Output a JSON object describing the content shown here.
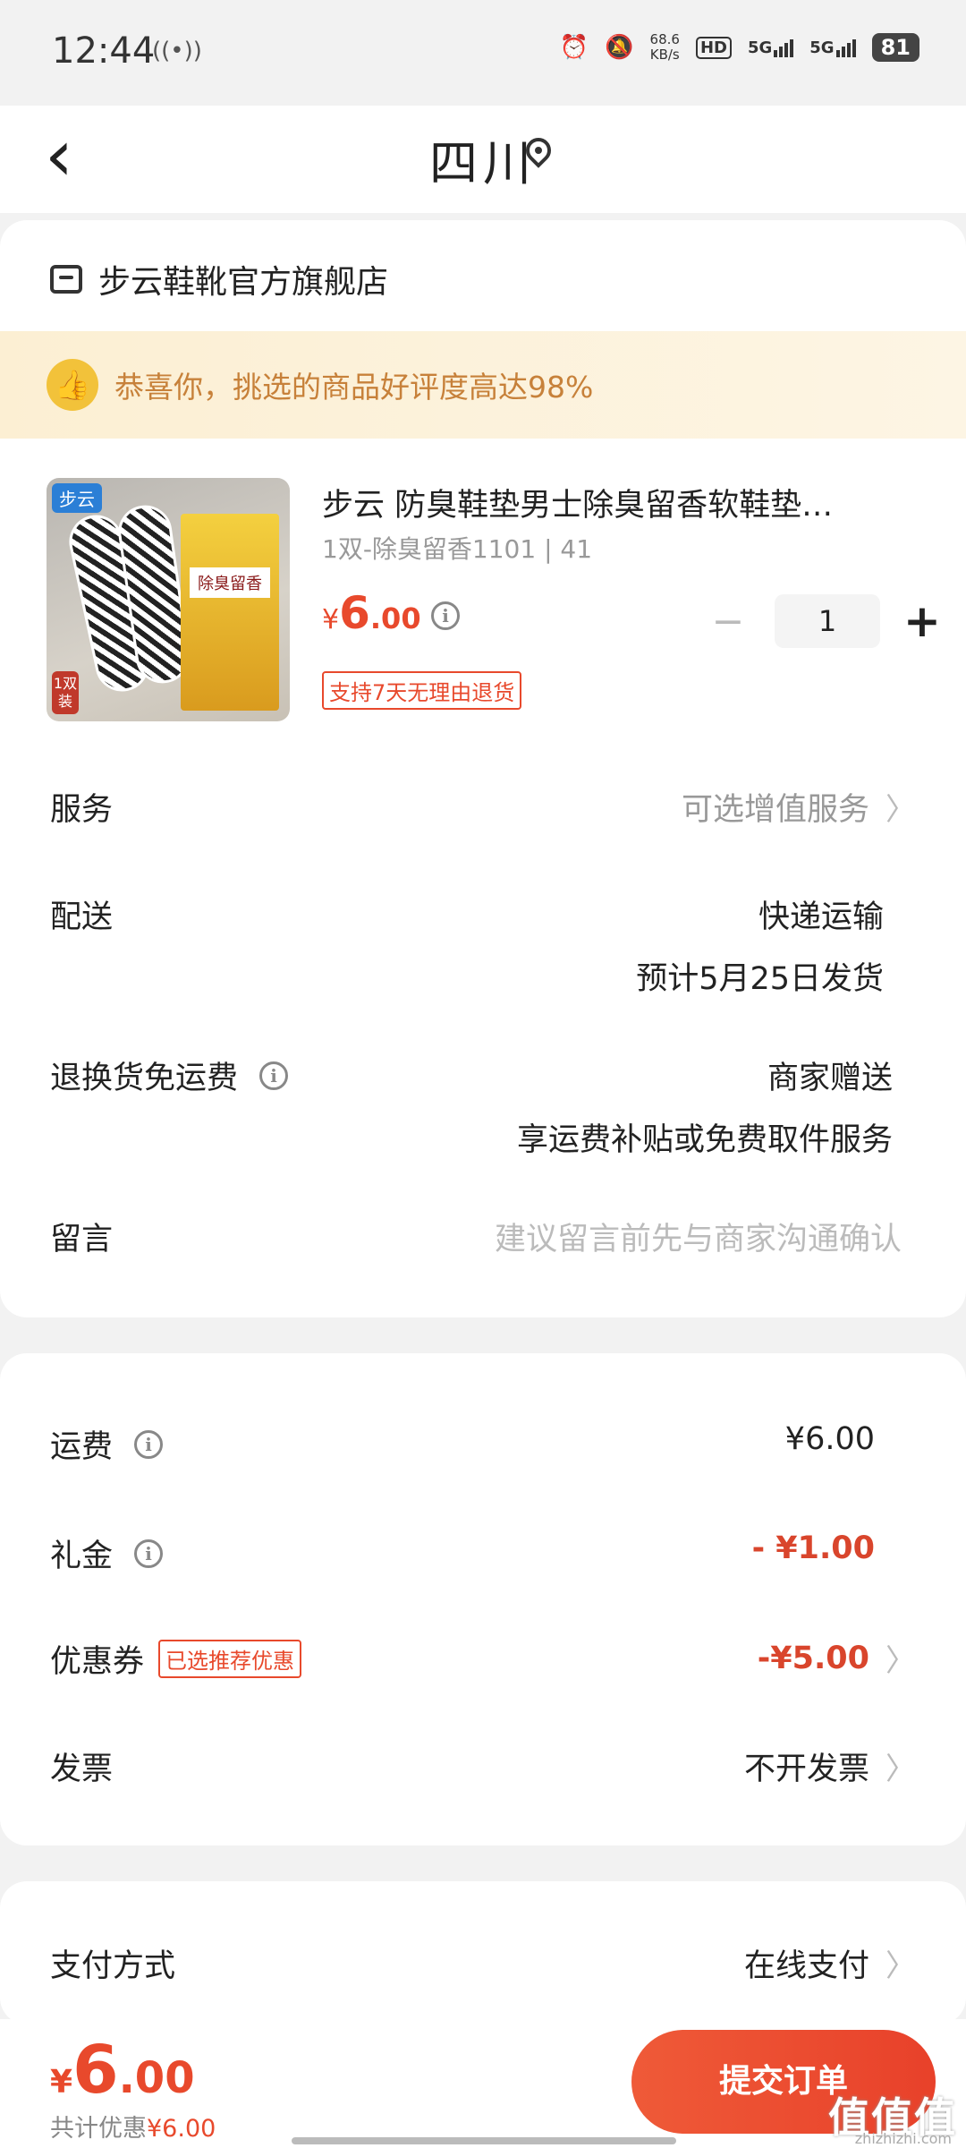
{
  "status": {
    "time": "12:44",
    "net_speed_value": "68.6",
    "net_speed_unit": "KB/s",
    "hd": "HD",
    "sim1": "5G",
    "sim2": "5G",
    "battery": "81"
  },
  "nav": {
    "back_glyph": "‹",
    "title": "四川"
  },
  "store": {
    "name": "步云鞋靴官方旗舰店"
  },
  "praise": {
    "text": "恭喜你，挑选的商品好评度高达98%"
  },
  "product": {
    "image_logo": "步云",
    "image_box_label": "除臭留香",
    "image_pair": "1双装",
    "title": "步云 防臭鞋垫男士除臭留香软鞋垫…",
    "spec": "1双-除臭留香1101 | 41",
    "price_currency": "¥",
    "price_int": "6",
    "price_dec": ".00",
    "quantity": "1",
    "minus_glyph": "−",
    "plus_glyph": "+",
    "return_badge": "支持7天无理由退货"
  },
  "rows": {
    "service_label": "服务",
    "service_value": "可选增值服务",
    "delivery_label": "配送",
    "delivery_method": "快递运输",
    "delivery_eta": "预计5月25日发货",
    "return_label": "退换货免运费",
    "return_value1": "商家赠送",
    "return_value2": "享运费补贴或免费取件服务",
    "note_label": "留言",
    "note_placeholder": "建议留言前先与商家沟通确认"
  },
  "fees": {
    "shipping_label": "运费",
    "shipping_value": "¥6.00",
    "gift_label": "礼金",
    "gift_value": "- ¥1.00",
    "coupon_label": "优惠券",
    "coupon_tag": "已选推荐优惠",
    "coupon_value": "-¥5.00",
    "invoice_label": "发票",
    "invoice_value": "不开发票"
  },
  "payment": {
    "label": "支付方式",
    "value": "在线支付"
  },
  "bottom": {
    "currency": "¥",
    "total_int": "6",
    "total_dec": ".00",
    "discount_prefix": "共计优惠",
    "discount_amount": "¥6.00",
    "submit": "提交订单"
  },
  "watermark": {
    "text": "值值值",
    "sub": "zhizhizhi.com"
  },
  "colors": {
    "accent": "#e8492c",
    "praise_text": "#c7813a",
    "praise_bg": "#fcefd3"
  },
  "icons": [
    "back-icon",
    "location-pin-icon",
    "store-icon",
    "thumbs-up-icon",
    "info-icon",
    "chevron-right-icon",
    "alarm-icon",
    "mute-icon"
  ]
}
